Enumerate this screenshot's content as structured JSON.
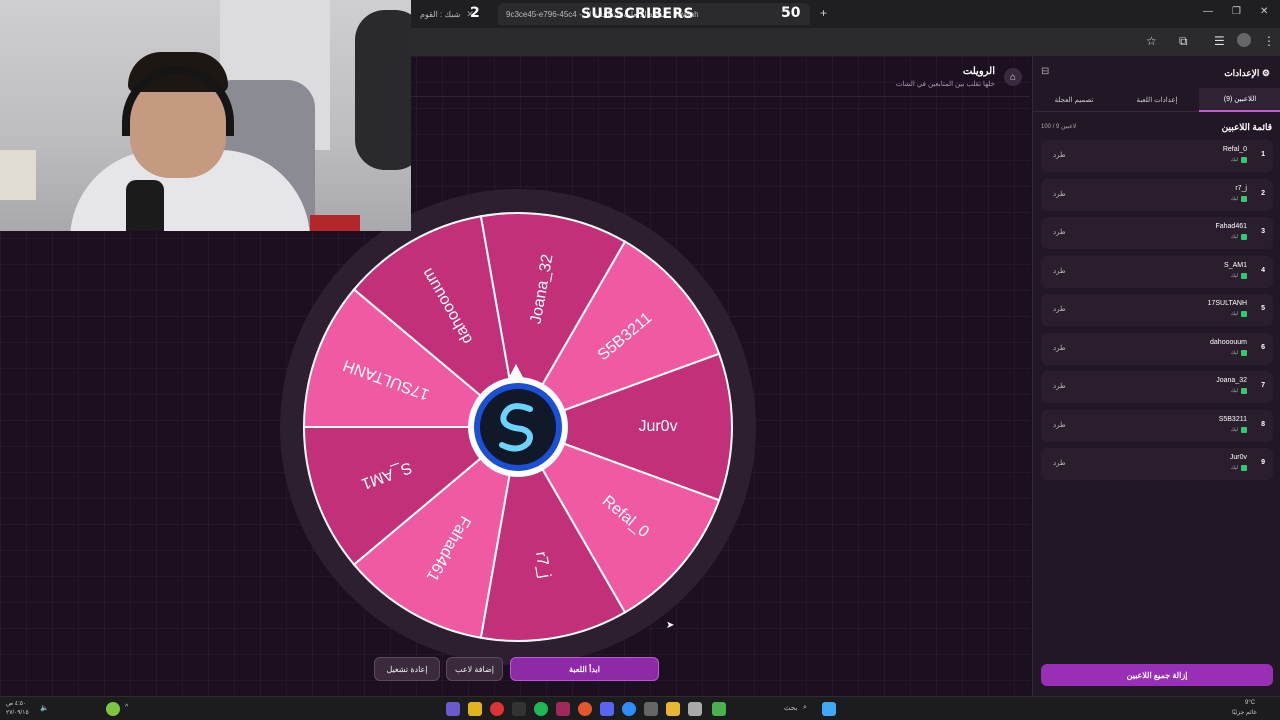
{
  "browser": {
    "tab1": "شبك : القوم",
    "tab2": "9c3ce45-e796-45c4 - منصة الألعاب التفاعلية للـ - Jawlah",
    "overlay_left_count": "2",
    "overlay_label": "SUBSCRIBERS",
    "overlay_right_count": "50"
  },
  "header": {
    "title": "الرويلت",
    "subtitle": "خلها تقلب بين المتابعين في الشات"
  },
  "wheel": {
    "segments": [
      "Joana_32",
      "S5B3211",
      "Jur0v",
      "Refal_0",
      "r7_j",
      "Fahad461",
      "S_AM1",
      "17SULTANH",
      "dahooouum"
    ],
    "colors": [
      "#c2307a",
      "#ef5aa2"
    ]
  },
  "buttons": {
    "start": "ابدأ اللعبة",
    "add_player": "إضافة لاعب",
    "reset": "إعادة تشغيل"
  },
  "sidebar": {
    "title": "الإعدادات",
    "tabs": [
      "اللاعبين (9)",
      "إعدادات اللعبة",
      "تصميم العجلة"
    ],
    "list_title": "قائمة اللاعبين",
    "count": "100 / 9 لاعبين",
    "players": [
      {
        "num": "1",
        "name": "Refal_0",
        "status": "ليك"
      },
      {
        "num": "2",
        "name": "r7_j",
        "status": "ليك"
      },
      {
        "num": "3",
        "name": "Fahad461",
        "status": "ليك"
      },
      {
        "num": "4",
        "name": "S_AM1",
        "status": "ليك"
      },
      {
        "num": "5",
        "name": "17SULTANH",
        "status": "ليك"
      },
      {
        "num": "6",
        "name": "dahooouum",
        "status": "ليك"
      },
      {
        "num": "7",
        "name": "Joana_32",
        "status": "ليك"
      },
      {
        "num": "8",
        "name": "S5B3211",
        "status": "ليك"
      },
      {
        "num": "9",
        "name": "Jur0v",
        "status": "ليك"
      }
    ],
    "kick_label": "طرد",
    "remove_all": "إزالة جميع اللاعبين"
  },
  "taskbar": {
    "search": "بحث",
    "weather_temp": "9°C",
    "weather_desc": "غائم جزئيًا",
    "time": "٤:٥٠ ص",
    "date": "٢٧/٠٩/١٥"
  }
}
